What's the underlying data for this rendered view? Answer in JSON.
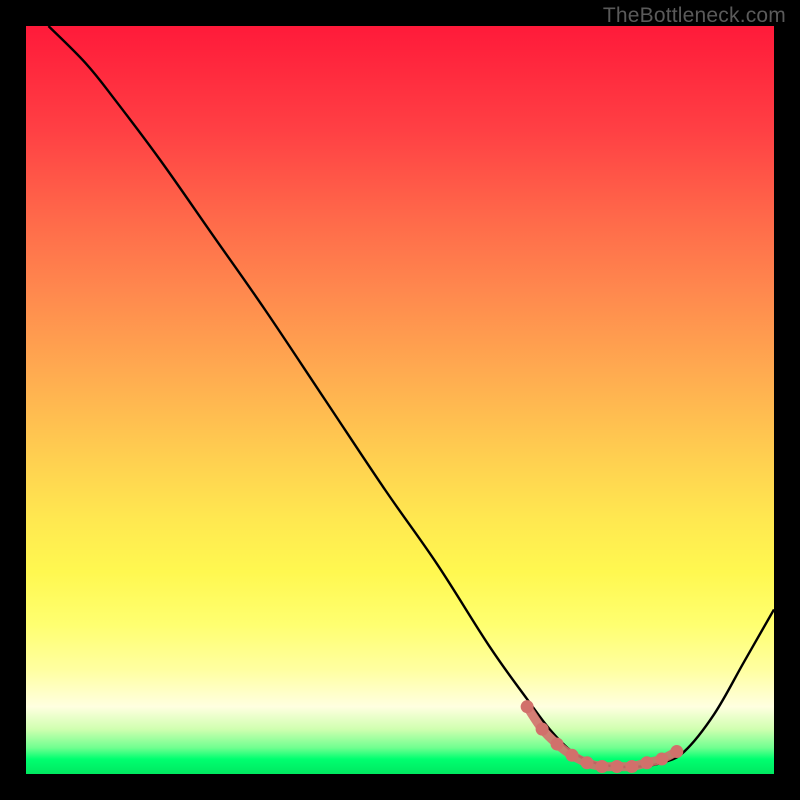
{
  "watermark": "TheBottleneck.com",
  "chart_data": {
    "type": "line",
    "title": "",
    "xlabel": "",
    "ylabel": "",
    "xlim": [
      0,
      100
    ],
    "ylim": [
      0,
      100
    ],
    "grid": false,
    "legend": false,
    "series": [
      {
        "name": "bottleneck-curve",
        "color": "#000000",
        "x": [
          3,
          8,
          12,
          18,
          25,
          32,
          40,
          48,
          55,
          62,
          67,
          70,
          73,
          76,
          79,
          82,
          85,
          88,
          92,
          96,
          100
        ],
        "y": [
          100,
          95,
          90,
          82,
          72,
          62,
          50,
          38,
          28,
          17,
          10,
          6,
          3,
          1.5,
          1,
          1,
          1.5,
          3,
          8,
          15,
          22
        ]
      }
    ],
    "markers": {
      "name": "optimum-range",
      "color": "#d1706b",
      "x": [
        67,
        69,
        71,
        73,
        75,
        77,
        79,
        81,
        83,
        85,
        87
      ],
      "y": [
        9,
        6,
        4,
        2.5,
        1.5,
        1,
        1,
        1,
        1.5,
        2,
        3
      ]
    }
  }
}
